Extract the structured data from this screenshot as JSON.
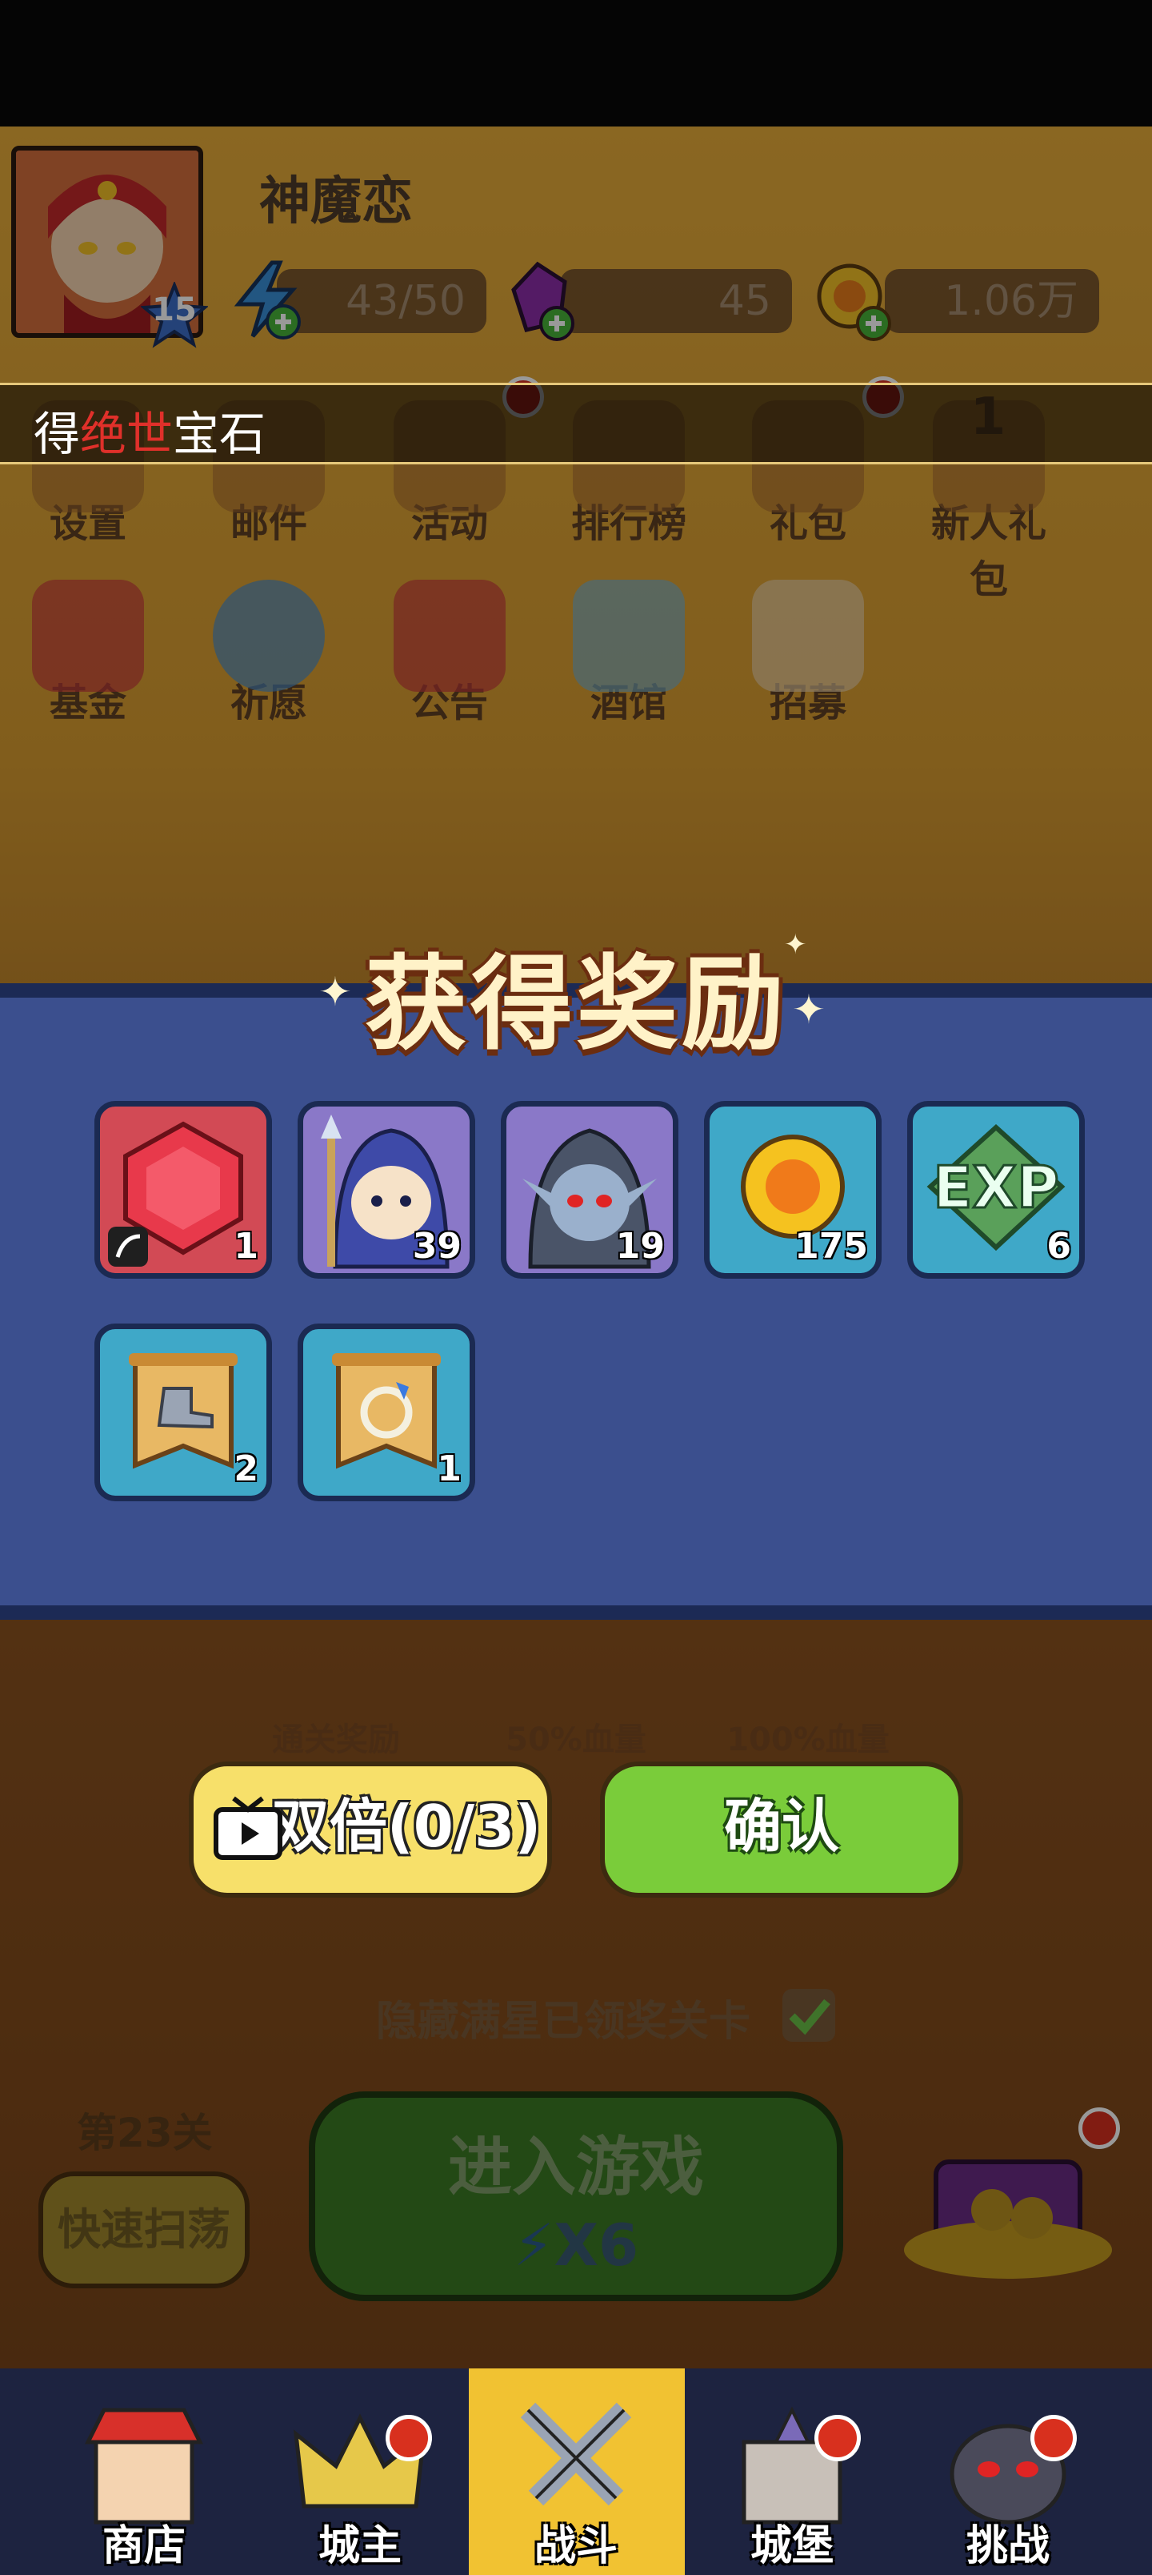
{
  "player": {
    "name": "神魔恋",
    "level": "15"
  },
  "resources": {
    "energy": "43/50",
    "gems": "45",
    "coins": "1.06万"
  },
  "marquee": {
    "prefix": "得",
    "highlight": "绝世",
    "suffix": "宝石"
  },
  "menu_row1": [
    "设置",
    "邮件",
    "活动",
    "排行榜",
    "礼包",
    "新人礼包"
  ],
  "menu_row2": [
    "基金",
    "祈愿",
    "公告",
    "酒馆",
    "招募"
  ],
  "newbie_badge": "1",
  "behind": {
    "reward_labels": [
      "通关奖励",
      "50%血量",
      "100%血量"
    ],
    "hide_text": "隐藏满星已领奖关卡",
    "stage": "第23关",
    "sweep_button": "快速扫荡",
    "enter_game": "进入游戏",
    "energy_cost": "X6"
  },
  "dialog": {
    "title": "获得奖励",
    "rewards": [
      {
        "icon": "ruby-gem-icon",
        "count": "1"
      },
      {
        "icon": "hooded-mage-hero-icon",
        "count": "39"
      },
      {
        "icon": "dark-elf-hero-icon",
        "count": "19"
      },
      {
        "icon": "gold-coin-icon",
        "count": "175"
      },
      {
        "icon": "exp-icon",
        "count": "6"
      },
      {
        "icon": "boot-scroll-icon",
        "count": "2"
      },
      {
        "icon": "ring-scroll-icon",
        "count": "1"
      }
    ],
    "double_button": "双倍(0/3)",
    "confirm_button": "确认"
  },
  "tabs": [
    "商店",
    "城主",
    "战斗",
    "城堡",
    "挑战"
  ],
  "colors": {
    "accent_red": "#e0302a",
    "confirm_green": "#7acc3a",
    "double_yellow": "#f7e06a",
    "panel_blue": "#3b4f8e"
  }
}
